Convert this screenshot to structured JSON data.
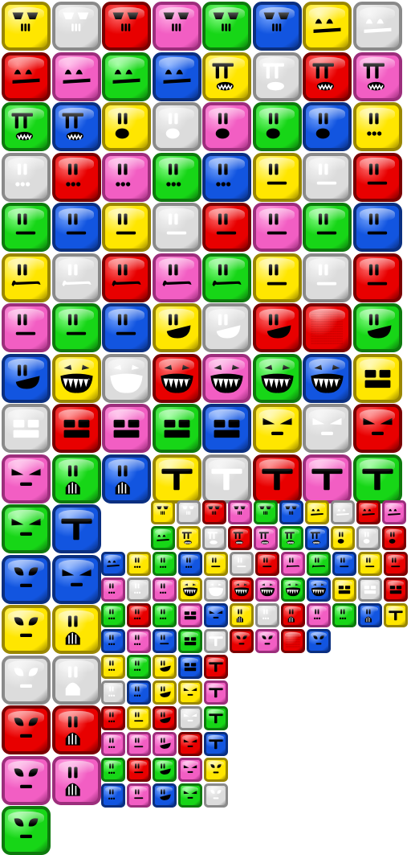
{
  "colors": {
    "yellow": {
      "fill": "#ffe600",
      "edge": "#9a8700",
      "light": "#fff8a0"
    },
    "gray": {
      "fill": "#dcdcdc",
      "edge": "#8a8a8a",
      "light": "#f4f4f4"
    },
    "red": {
      "fill": "#e80000",
      "edge": "#7a0000",
      "light": "#ff7070"
    },
    "pink": {
      "fill": "#f25ec3",
      "edge": "#9c2e7c",
      "light": "#ffb0e6"
    },
    "green": {
      "fill": "#17d617",
      "edge": "#0d7a0d",
      "light": "#8cff8c"
    },
    "blue": {
      "fill": "#1255e0",
      "edge": "#0a2f80",
      "light": "#7aa8ff"
    },
    "feature_dark": "#000000",
    "feature_on_gray": "#ffffff"
  },
  "face_types": [
    "brow-eyes",
    "dome-eyes",
    "pi-grin",
    "oval-mouth",
    "dot-mouth",
    "flat-mouth",
    "frown",
    "smirk",
    "sharp-teeth",
    "blocky",
    "v-eyes",
    "striped-mouth",
    "t-face",
    "alien-eyes"
  ],
  "large_tiles": [
    {
      "c": "yellow",
      "f": "brow-eyes"
    },
    {
      "c": "gray",
      "f": "brow-eyes"
    },
    {
      "c": "red",
      "f": "brow-eyes"
    },
    {
      "c": "pink",
      "f": "brow-eyes"
    },
    {
      "c": "green",
      "f": "brow-eyes"
    },
    {
      "c": "blue",
      "f": "brow-eyes"
    },
    {
      "c": "yellow",
      "f": "dome-eyes"
    },
    {
      "c": "gray",
      "f": "dome-eyes"
    },
    {
      "c": "red",
      "f": "dome-eyes"
    },
    {
      "c": "pink",
      "f": "dome-eyes"
    },
    {
      "c": "green",
      "f": "dome-eyes"
    },
    {
      "c": "blue",
      "f": "dome-eyes"
    },
    {
      "c": "yellow",
      "f": "pi-grin"
    },
    {
      "c": "gray",
      "f": "pi-grin"
    },
    {
      "c": "red",
      "f": "pi-grin"
    },
    {
      "c": "pink",
      "f": "pi-grin"
    },
    {
      "c": "green",
      "f": "pi-grin"
    },
    {
      "c": "blue",
      "f": "pi-grin"
    },
    {
      "c": "yellow",
      "f": "oval-mouth"
    },
    {
      "c": "gray",
      "f": "oval-mouth"
    },
    {
      "c": "pink",
      "f": "oval-mouth"
    },
    {
      "c": "green",
      "f": "oval-mouth"
    },
    {
      "c": "blue",
      "f": "oval-mouth"
    },
    {
      "c": "yellow",
      "f": "dot-mouth"
    },
    {
      "c": "gray",
      "f": "dot-mouth"
    },
    {
      "c": "red",
      "f": "dot-mouth"
    },
    {
      "c": "pink",
      "f": "dot-mouth"
    },
    {
      "c": "green",
      "f": "dot-mouth"
    },
    {
      "c": "blue",
      "f": "dot-mouth"
    },
    {
      "c": "yellow",
      "f": "flat-mouth"
    },
    {
      "c": "gray",
      "f": "flat-mouth"
    },
    {
      "c": "red",
      "f": "flat-mouth"
    },
    {
      "c": "green",
      "f": "flat-mouth"
    },
    {
      "c": "blue",
      "f": "flat-mouth"
    },
    {
      "c": "yellow",
      "f": "flat-mouth"
    },
    {
      "c": "gray",
      "f": "flat-mouth"
    },
    {
      "c": "red",
      "f": "flat-mouth"
    },
    {
      "c": "pink",
      "f": "flat-mouth"
    },
    {
      "c": "green",
      "f": "flat-mouth"
    },
    {
      "c": "blue",
      "f": "flat-mouth"
    },
    {
      "c": "yellow",
      "f": "frown"
    },
    {
      "c": "gray",
      "f": "frown"
    },
    {
      "c": "red",
      "f": "frown"
    },
    {
      "c": "pink",
      "f": "frown"
    },
    {
      "c": "green",
      "f": "frown"
    },
    {
      "c": "yellow",
      "f": "flat-mouth"
    },
    {
      "c": "gray",
      "f": "flat-mouth"
    },
    {
      "c": "red",
      "f": "flat-mouth"
    },
    {
      "c": "pink",
      "f": "flat-mouth"
    },
    {
      "c": "green",
      "f": "flat-mouth"
    },
    {
      "c": "blue",
      "f": "flat-mouth"
    },
    {
      "c": "yellow",
      "f": "smirk"
    },
    {
      "c": "gray",
      "f": "smirk"
    },
    {
      "c": "red",
      "f": "smirk"
    },
    {
      "c": "red",
      "f": "noise"
    },
    {
      "c": "green",
      "f": "smirk"
    },
    {
      "c": "blue",
      "f": "smirk"
    },
    {
      "c": "yellow",
      "f": "sharp-teeth"
    },
    {
      "c": "gray",
      "f": "sharp-teeth"
    },
    {
      "c": "red",
      "f": "sharp-teeth"
    },
    {
      "c": "pink",
      "f": "sharp-teeth"
    },
    {
      "c": "green",
      "f": "sharp-teeth"
    },
    {
      "c": "blue",
      "f": "sharp-teeth"
    },
    {
      "c": "yellow",
      "f": "blocky"
    },
    {
      "c": "gray",
      "f": "blocky"
    },
    {
      "c": "red",
      "f": "blocky"
    },
    {
      "c": "pink",
      "f": "blocky"
    },
    {
      "c": "green",
      "f": "blocky"
    },
    {
      "c": "blue",
      "f": "blocky"
    },
    {
      "c": "yellow",
      "f": "v-eyes"
    },
    {
      "c": "gray",
      "f": "v-eyes"
    },
    {
      "c": "red",
      "f": "v-eyes"
    },
    {
      "c": "pink",
      "f": "v-eyes"
    },
    {
      "c": "green",
      "f": "striped-mouth"
    },
    {
      "c": "blue",
      "f": "striped-mouth"
    },
    {
      "c": "yellow",
      "f": "t-face"
    },
    {
      "c": "gray",
      "f": "t-face"
    },
    {
      "c": "red",
      "f": "t-face"
    },
    {
      "c": "pink",
      "f": "t-face"
    },
    {
      "c": "green",
      "f": "t-face"
    },
    {
      "c": "green",
      "f": "v-eyes"
    },
    {
      "c": "blue",
      "f": "t-face"
    },
    {
      "c": "blue",
      "f": "alien-eyes"
    },
    {
      "c": "blue",
      "f": "v-eyes"
    },
    {
      "c": "yellow",
      "f": "alien-eyes"
    },
    {
      "c": "yellow",
      "f": "striped-mouth"
    },
    {
      "c": "gray",
      "f": "alien-eyes"
    },
    {
      "c": "gray",
      "f": "striped-mouth"
    },
    {
      "c": "red",
      "f": "alien-eyes"
    },
    {
      "c": "red",
      "f": "striped-mouth"
    },
    {
      "c": "pink",
      "f": "alien-eyes"
    },
    {
      "c": "pink",
      "f": "striped-mouth"
    },
    {
      "c": "green",
      "f": "alien-eyes"
    }
  ],
  "small_tiles": [
    {
      "c": "yellow",
      "f": "brow-eyes"
    },
    {
      "c": "gray",
      "f": "brow-eyes"
    },
    {
      "c": "red",
      "f": "brow-eyes"
    },
    {
      "c": "pink",
      "f": "brow-eyes"
    },
    {
      "c": "green",
      "f": "brow-eyes"
    },
    {
      "c": "blue",
      "f": "brow-eyes"
    },
    {
      "c": "yellow",
      "f": "dome-eyes"
    },
    {
      "c": "gray",
      "f": "dome-eyes"
    },
    {
      "c": "red",
      "f": "dome-eyes"
    },
    {
      "c": "pink",
      "f": "dome-eyes"
    },
    {
      "c": "green",
      "f": "dome-eyes"
    },
    {
      "c": "yellow",
      "f": "pi-grin"
    },
    {
      "c": "gray",
      "f": "pi-grin"
    },
    {
      "c": "red",
      "f": "pi-grin"
    },
    {
      "c": "pink",
      "f": "pi-grin"
    },
    {
      "c": "green",
      "f": "pi-grin"
    },
    {
      "c": "blue",
      "f": "pi-grin"
    },
    {
      "c": "yellow",
      "f": "oval-mouth"
    },
    {
      "c": "gray",
      "f": "oval-mouth"
    },
    {
      "c": "red",
      "f": "oval-mouth"
    },
    {
      "c": "blue",
      "f": "dome-eyes"
    },
    {
      "c": "yellow",
      "f": "dot-mouth"
    },
    {
      "c": "green",
      "f": "dot-mouth"
    },
    {
      "c": "blue",
      "f": "dot-mouth"
    },
    {
      "c": "yellow",
      "f": "flat-mouth"
    },
    {
      "c": "gray",
      "f": "flat-mouth"
    },
    {
      "c": "red",
      "f": "flat-mouth"
    },
    {
      "c": "pink",
      "f": "frown"
    },
    {
      "c": "green",
      "f": "frown"
    },
    {
      "c": "blue",
      "f": "flat-mouth"
    },
    {
      "c": "yellow",
      "f": "flat-mouth"
    },
    {
      "c": "red",
      "f": "flat-mouth"
    },
    {
      "c": "pink",
      "f": "dot-mouth"
    },
    {
      "c": "gray",
      "f": "dot-mouth"
    },
    {
      "c": "pink",
      "f": "dot-mouth"
    },
    {
      "c": "yellow",
      "f": "sharp-teeth"
    },
    {
      "c": "gray",
      "f": "sharp-teeth"
    },
    {
      "c": "red",
      "f": "sharp-teeth"
    },
    {
      "c": "pink",
      "f": "sharp-teeth"
    },
    {
      "c": "green",
      "f": "sharp-teeth"
    },
    {
      "c": "blue",
      "f": "sharp-teeth"
    },
    {
      "c": "yellow",
      "f": "blocky"
    },
    {
      "c": "gray",
      "f": "blocky"
    },
    {
      "c": "red",
      "f": "blocky"
    },
    {
      "c": "green",
      "f": "dot-mouth"
    },
    {
      "c": "red",
      "f": "dot-mouth"
    },
    {
      "c": "green",
      "f": "dot-mouth"
    },
    {
      "c": "pink",
      "f": "blocky"
    },
    {
      "c": "blue",
      "f": "v-eyes"
    },
    {
      "c": "yellow",
      "f": "striped-mouth"
    },
    {
      "c": "gray",
      "f": "dot-mouth"
    },
    {
      "c": "red",
      "f": "striped-mouth"
    },
    {
      "c": "pink",
      "f": "dot-mouth"
    },
    {
      "c": "green",
      "f": "dot-mouth"
    },
    {
      "c": "blue",
      "f": "striped-mouth"
    },
    {
      "c": "yellow",
      "f": "t-face"
    },
    {
      "c": "blue",
      "f": "dot-mouth"
    },
    {
      "c": "pink",
      "f": "dot-mouth"
    },
    {
      "c": "blue",
      "f": "flat-mouth"
    },
    {
      "c": "green",
      "f": "blocky"
    },
    {
      "c": "gray",
      "f": "t-face"
    },
    {
      "c": "red",
      "f": "alien-eyes"
    },
    {
      "c": "pink",
      "f": "alien-eyes"
    },
    {
      "c": "red",
      "f": "noise"
    },
    {
      "c": "blue",
      "f": "alien-eyes"
    },
    {
      "c": "yellow",
      "f": "dot-mouth"
    },
    {
      "c": "green",
      "f": "dot-mouth"
    },
    {
      "c": "yellow",
      "f": "smirk"
    },
    {
      "c": "blue",
      "f": "blocky"
    },
    {
      "c": "red",
      "f": "t-face"
    },
    {
      "c": "gray",
      "f": "dot-mouth"
    },
    {
      "c": "blue",
      "f": "dot-mouth"
    },
    {
      "c": "yellow",
      "f": "smirk"
    },
    {
      "c": "yellow",
      "f": "v-eyes"
    },
    {
      "c": "pink",
      "f": "t-face"
    },
    {
      "c": "red",
      "f": "dot-mouth"
    },
    {
      "c": "yellow",
      "f": "flat-mouth"
    },
    {
      "c": "red",
      "f": "smirk"
    },
    {
      "c": "gray",
      "f": "v-eyes"
    },
    {
      "c": "green",
      "f": "t-face"
    },
    {
      "c": "pink",
      "f": "dot-mouth"
    },
    {
      "c": "pink",
      "f": "flat-mouth"
    },
    {
      "c": "pink",
      "f": "smirk"
    },
    {
      "c": "red",
      "f": "v-eyes"
    },
    {
      "c": "blue",
      "f": "t-face"
    },
    {
      "c": "green",
      "f": "dot-mouth"
    },
    {
      "c": "red",
      "f": "flat-mouth"
    },
    {
      "c": "green",
      "f": "smirk"
    },
    {
      "c": "pink",
      "f": "v-eyes"
    },
    {
      "c": "yellow",
      "f": "alien-eyes"
    },
    {
      "c": "blue",
      "f": "dot-mouth"
    },
    {
      "c": "pink",
      "f": "flat-mouth"
    },
    {
      "c": "blue",
      "f": "smirk"
    },
    {
      "c": "green",
      "f": "v-eyes"
    },
    {
      "c": "gray",
      "f": "alien-eyes"
    }
  ]
}
